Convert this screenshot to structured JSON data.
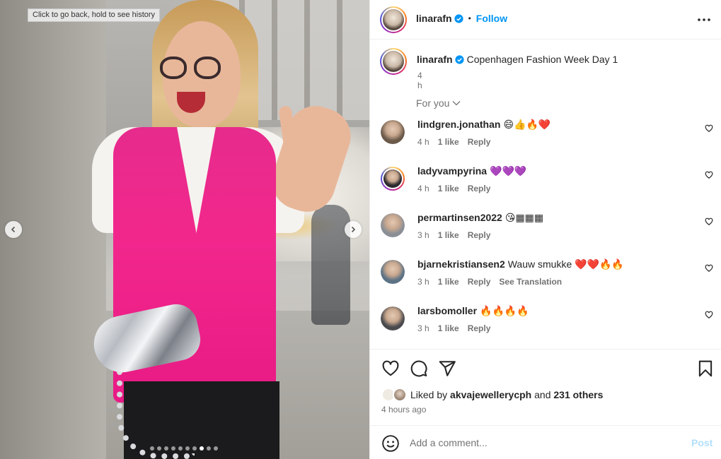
{
  "photo": {
    "tooltip": "Click to go back, hold to see history",
    "carousel_dot_count": 10,
    "carousel_active_index": 7
  },
  "header": {
    "username": "linarafn",
    "separator": "•",
    "follow_label": "Follow"
  },
  "caption": {
    "username": "linarafn",
    "text": "Copenhagen Fashion Week Day 1",
    "time": "4 h"
  },
  "sort": {
    "label": "For you"
  },
  "comments": [
    {
      "user": "lindgren.jonathan",
      "text": "😄👍🔥❤️",
      "time": "4 h",
      "likes": "1 like",
      "reply": "Reply",
      "avatar_color": "#6b5a4a",
      "ring": false
    },
    {
      "user": "ladyvampyrina",
      "text": "💜💜💜",
      "time": "4 h",
      "likes": "1 like",
      "reply": "Reply",
      "avatar_color": "#2c2a2e",
      "ring": true
    },
    {
      "user": "permartinsen2022",
      "text": "😘▦▦▦",
      "time": "3 h",
      "likes": "1 like",
      "reply": "Reply",
      "avatar_color": "#8a8f96",
      "ring": false
    },
    {
      "user": "bjarnekristiansen2",
      "text": "Wauw smukke ❤️❤️🔥🔥",
      "time": "3 h",
      "likes": "1 like",
      "reply": "Reply",
      "translate": "See Translation",
      "avatar_color": "#5d7285",
      "ring": false
    },
    {
      "user": "larsbomoller",
      "text": "🔥🔥🔥🔥",
      "time": "3 h",
      "likes": "1 like",
      "reply": "Reply",
      "avatar_color": "#4a4a4e",
      "ring": false
    }
  ],
  "likes": {
    "prefix": "Liked by",
    "user": "akvajewellerycph",
    "middle": "and",
    "others": "231 others",
    "time_ago": "4 hours ago"
  },
  "add_comment": {
    "placeholder": "Add a comment...",
    "post_label": "Post"
  },
  "colors": {
    "accent": "#0095f6",
    "post_disabled": "#b2dffc",
    "muted": "#737373"
  }
}
